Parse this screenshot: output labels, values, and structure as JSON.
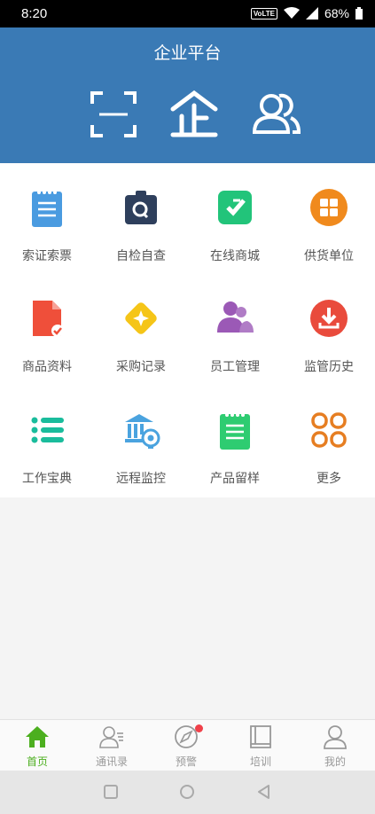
{
  "status_bar": {
    "time": "8:20",
    "volte": "VoLTE",
    "battery": "68%"
  },
  "header": {
    "title": "企业平台",
    "icons": [
      "scan-icon",
      "enterprise-icon",
      "contacts-icon"
    ]
  },
  "grid": {
    "items": [
      {
        "label": "索证索票",
        "icon": "notebook-icon",
        "color": "#4a9be0"
      },
      {
        "label": "自检自查",
        "icon": "self-check-icon",
        "color": "#2e3f5c"
      },
      {
        "label": "在线商城",
        "icon": "shop-icon",
        "color": "#22c47a"
      },
      {
        "label": "供货单位",
        "icon": "supplier-icon",
        "color": "#f08a1d"
      },
      {
        "label": "商品资料",
        "icon": "document-icon",
        "color": "#ef4f3a"
      },
      {
        "label": "采购记录",
        "icon": "purchase-icon",
        "color": "#f5c518"
      },
      {
        "label": "员工管理",
        "icon": "staff-icon",
        "color": "#9b59b6"
      },
      {
        "label": "监管历史",
        "icon": "download-icon",
        "color": "#e94b3c"
      },
      {
        "label": "工作宝典",
        "icon": "list-icon",
        "color": "#1abc9c"
      },
      {
        "label": "远程监控",
        "icon": "camera-bank-icon",
        "color": "#4aa3df"
      },
      {
        "label": "产品留样",
        "icon": "sample-icon",
        "color": "#2ecc71"
      },
      {
        "label": "更多",
        "icon": "more-icon",
        "color": "#e67e22"
      }
    ]
  },
  "tabbar": {
    "tabs": [
      {
        "label": "首页",
        "icon": "home-icon",
        "active": true
      },
      {
        "label": "通讯录",
        "icon": "address-book-icon",
        "active": false
      },
      {
        "label": "预警",
        "icon": "compass-icon",
        "active": false,
        "badge": true
      },
      {
        "label": "培训",
        "icon": "book-icon",
        "active": false
      },
      {
        "label": "我的",
        "icon": "user-icon",
        "active": false
      }
    ],
    "active_color": "#4caf1f",
    "badge_color": "#f0414a"
  },
  "colors": {
    "header_bg": "#3a7ab5",
    "grid_bg": "#ffffff",
    "page_bg": "#f4f4f4"
  }
}
